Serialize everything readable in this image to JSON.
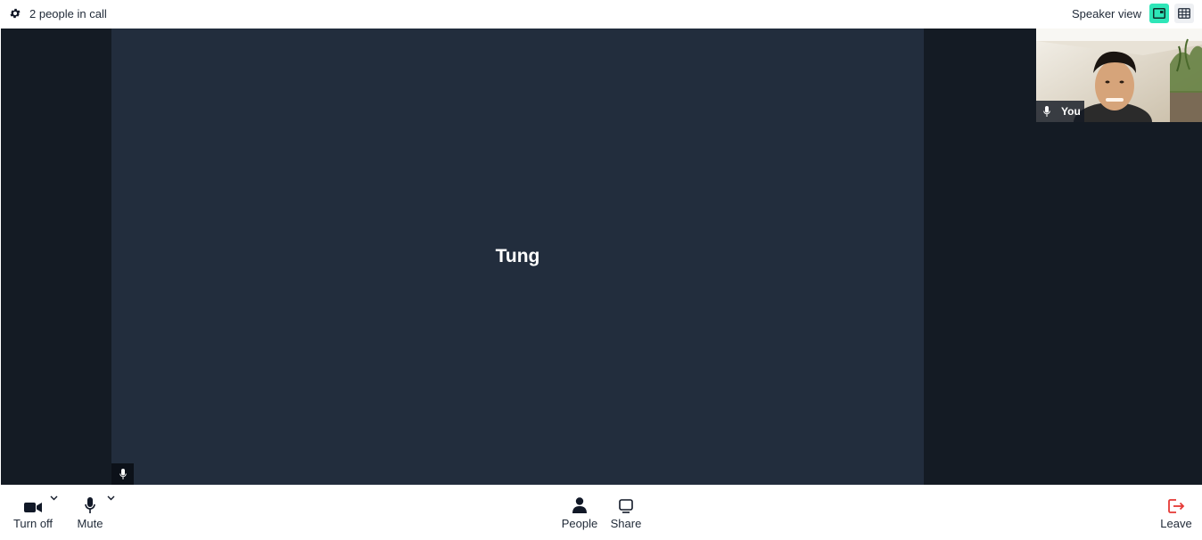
{
  "topbar": {
    "participant_count_label": "2 people in call",
    "view_mode_label": "Speaker view",
    "settings_icon": "gear-icon",
    "speaker_view_icon": "speaker-layout-icon",
    "grid_view_icon": "grid-layout-icon",
    "active_view": "speaker",
    "accent_color": "#2ee6b8"
  },
  "stage": {
    "active_speaker_name": "Tung",
    "active_speaker_mic_icon": "microphone-icon",
    "self_view": {
      "label": "You",
      "mic_icon": "microphone-icon"
    }
  },
  "toolbar": {
    "camera": {
      "label": "Turn off",
      "icon": "video-camera-icon",
      "has_menu": true
    },
    "mic": {
      "label": "Mute",
      "icon": "microphone-icon",
      "has_menu": true
    },
    "people": {
      "label": "People",
      "icon": "person-icon"
    },
    "share": {
      "label": "Share",
      "icon": "screen-share-icon"
    },
    "leave": {
      "label": "Leave",
      "icon": "leave-icon",
      "color": "#e53935"
    }
  }
}
